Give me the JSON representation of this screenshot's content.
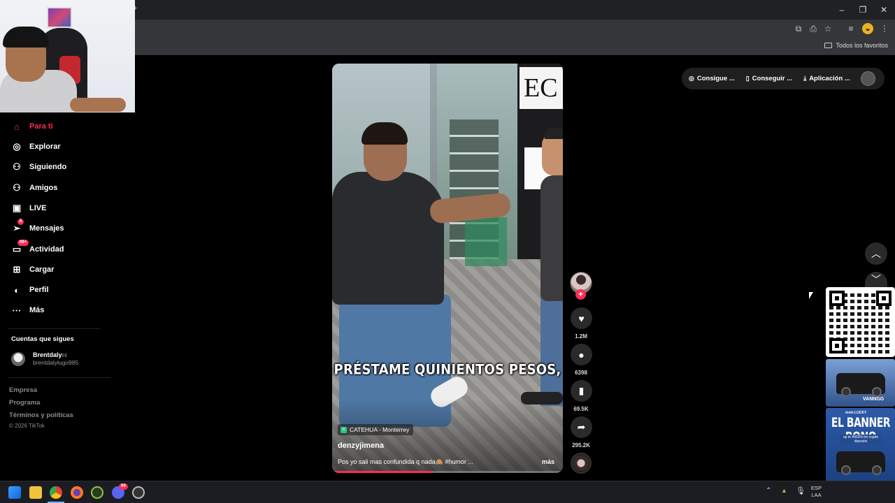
{
  "browser": {
    "bookmarks_all": "Todos los favoritos",
    "window_controls": {
      "minimize": "–",
      "maximize": "❐",
      "close": "✕"
    },
    "tab_new": "+"
  },
  "sidebar": {
    "items": [
      {
        "label": "Para ti",
        "icon": "home-icon",
        "glyph": "⌂",
        "active": true
      },
      {
        "label": "Explorar",
        "icon": "compass-icon",
        "glyph": "◎"
      },
      {
        "label": "Siguiendo",
        "icon": "following-icon",
        "glyph": "⚇"
      },
      {
        "label": "Amigos",
        "icon": "friends-icon",
        "glyph": "⚇"
      },
      {
        "label": "LIVE",
        "icon": "live-tv-icon",
        "glyph": "▣"
      },
      {
        "label": "Mensajes",
        "icon": "messages-icon",
        "glyph": "➢",
        "badge": "5"
      },
      {
        "label": "Actividad",
        "icon": "activity-icon",
        "glyph": "▭",
        "badge": "99+"
      },
      {
        "label": "Cargar",
        "icon": "upload-icon",
        "glyph": "⊞"
      },
      {
        "label": "Perfil",
        "icon": "profile-icon",
        "glyph": "◐"
      },
      {
        "label": "Más",
        "icon": "more-icon",
        "glyph": "···"
      }
    ],
    "following_title": "Cuentas que sigues",
    "following_account": {
      "name": "Brentdaly",
      "name_suffix": "PE",
      "username": "brentdalylugo985"
    },
    "footer_links": [
      "Empresa",
      "Programa",
      "Términos y políticas"
    ],
    "copyright": "© 2026 TikTok"
  },
  "top_bar": {
    "items": [
      {
        "label": "Consigue ...",
        "icon": "coin-icon",
        "glyph": "◎"
      },
      {
        "label": "Conseguir ...",
        "icon": "phone-icon",
        "glyph": "▯"
      },
      {
        "label": "Aplicación ...",
        "icon": "download-icon",
        "glyph": "⤓"
      }
    ]
  },
  "video": {
    "caption_overlay": "PRÉSTAME QUINIENTOS PESOS,",
    "location": "CATEHUA - Monterrey",
    "author": "denzyjimena",
    "description": "Pos yo sali mas confundida q nada🙈 #humor ...",
    "more": "más",
    "progress": 0.43,
    "store_sign": "EC"
  },
  "actions": {
    "likes": "1.2M",
    "comments": "6398",
    "saves": "69.5K",
    "shares": "295.2K"
  },
  "ads": {
    "banner_title": "EL BANNER BONO",
    "banner_sub": "up to ¥600% for crypto deposits",
    "brand": "VANNGG",
    "logos": "mvin  LUCKY"
  },
  "taskbar": {
    "lang_top": "ESP",
    "lang_bottom": "LAA",
    "discord_badge": "99"
  },
  "colors": {
    "accent": "#fe2c55",
    "background": "#000000",
    "chrome": "#35363a"
  }
}
